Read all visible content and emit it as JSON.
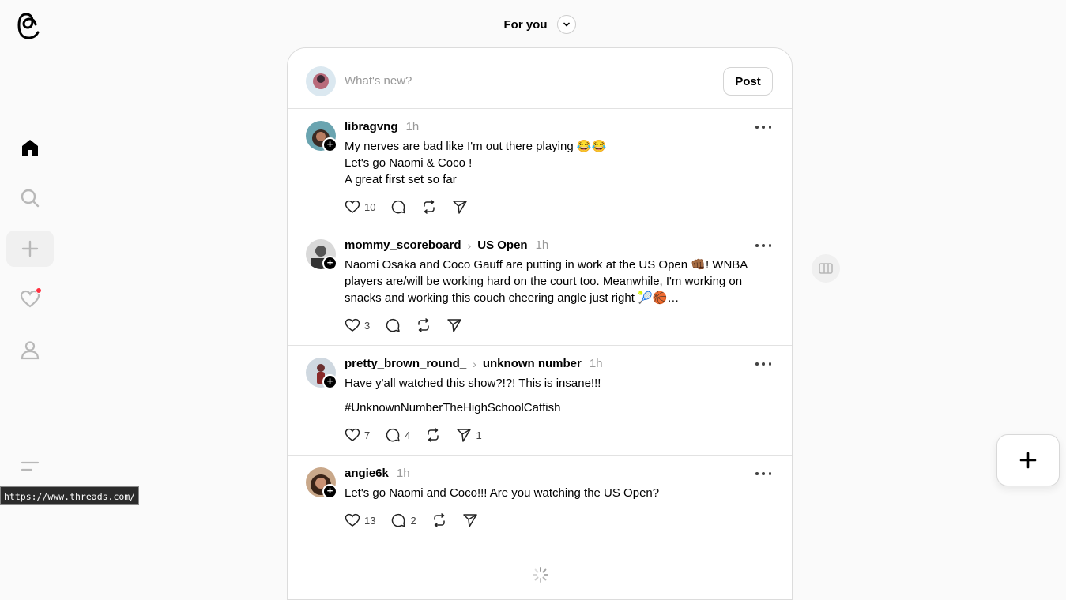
{
  "header": {
    "title": "For you"
  },
  "composer": {
    "placeholder": "What's new?",
    "post_label": "Post"
  },
  "status_url": "https://www.threads.com/",
  "sidebar": {
    "items": [
      {
        "name": "home-icon",
        "active": true
      },
      {
        "name": "search-icon",
        "active": false
      },
      {
        "name": "create-icon",
        "active": false
      },
      {
        "name": "activity-icon",
        "active": false,
        "badge": true
      },
      {
        "name": "profile-icon",
        "active": false
      }
    ]
  },
  "posts": [
    {
      "username": "libragvng",
      "topic": "",
      "time": "1h",
      "lines": [
        "My nerves are bad like I'm out there playing 😂😂",
        "Let's go Naomi & Coco !",
        "A great first set so far"
      ],
      "likes": "10",
      "replies": "",
      "reposts": "",
      "shares": "",
      "avatar_color": "#6aa4b0"
    },
    {
      "username": "mommy_scoreboard",
      "topic": "US Open",
      "time": "1h",
      "lines": [
        "Naomi Osaka and Coco Gauff are putting in work at the US Open 👊🏾! WNBA players are/will be working hard on the court too. Meanwhile, I'm working on snacks and working this couch cheering angle just right 🎾🏀…"
      ],
      "likes": "3",
      "replies": "",
      "reposts": "",
      "shares": "",
      "avatar_color": "#7a7a7a"
    },
    {
      "username": "pretty_brown_round_",
      "topic": "unknown number",
      "time": "1h",
      "lines": [
        "Have y'all watched this show?!?! This is insane!!!",
        "",
        "#UnknownNumberTheHighSchoolCatfish"
      ],
      "likes": "7",
      "replies": "4",
      "reposts": "",
      "shares": "1",
      "avatar_color": "#5a6f86"
    },
    {
      "username": "angie6k",
      "topic": "",
      "time": "1h",
      "lines": [
        "Let's go Naomi and Coco!!! Are you watching the US Open?"
      ],
      "likes": "13",
      "replies": "2",
      "reposts": "",
      "shares": "",
      "avatar_color": "#8a5a3c"
    }
  ]
}
